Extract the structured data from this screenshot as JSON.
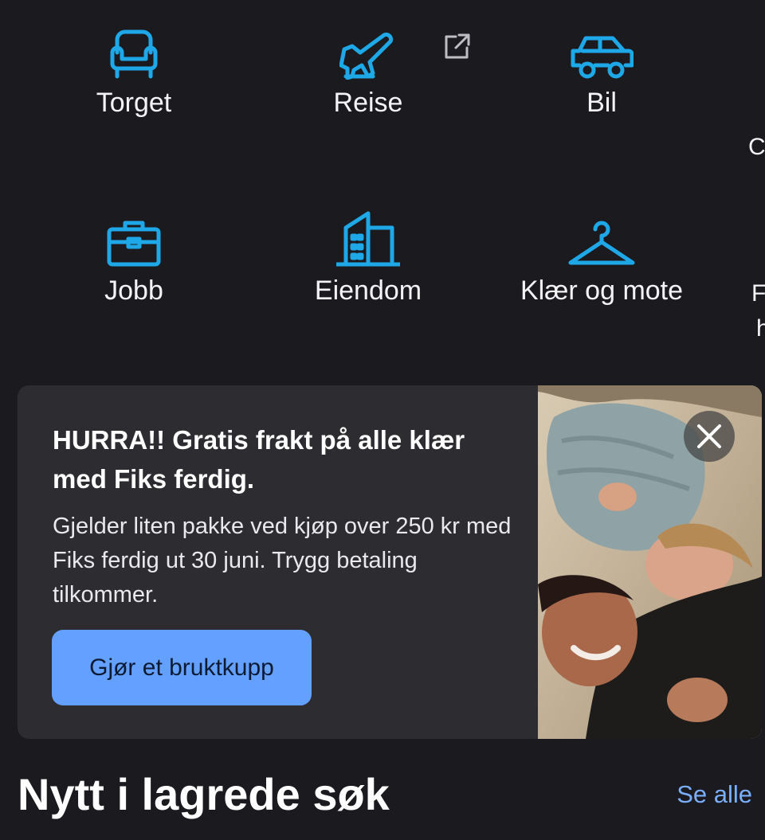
{
  "categories": [
    {
      "label": "Torget",
      "icon": "armchair-icon"
    },
    {
      "label": "Reise",
      "icon": "airplane-departure-icon",
      "external_icon": "external-link-icon"
    },
    {
      "label": "Bil",
      "icon": "car-icon"
    },
    {
      "label": "Jobb",
      "icon": "briefcase-icon"
    },
    {
      "label": "Eiendom",
      "icon": "buildings-icon"
    },
    {
      "label": "Klær og mote",
      "icon": "hanger-icon"
    }
  ],
  "edge_glyphs": {
    "row1": "C",
    "row2a": "F",
    "row2b": "h"
  },
  "promo": {
    "title": "HURRA!! Gratis frakt på alle klær med Fiks ferdig.",
    "body": "Gjelder liten pakke ved kjøp over 250 kr med Fiks ferdig ut 30 juni. Trygg betaling tilkommer.",
    "button_label": "Gjør et bruktkupp",
    "close_icon": "close-icon",
    "image": "mother-and-child-lying-on-rug-photo"
  },
  "saved_searches": {
    "title": "Nytt i lagrede søk",
    "see_all_label": "Se alle"
  },
  "colors": {
    "background": "#1b1b1f",
    "card": "#2c2c31",
    "icon_accent": "#1fa8e8",
    "button": "#64a0ff",
    "link": "#7aaeff"
  }
}
